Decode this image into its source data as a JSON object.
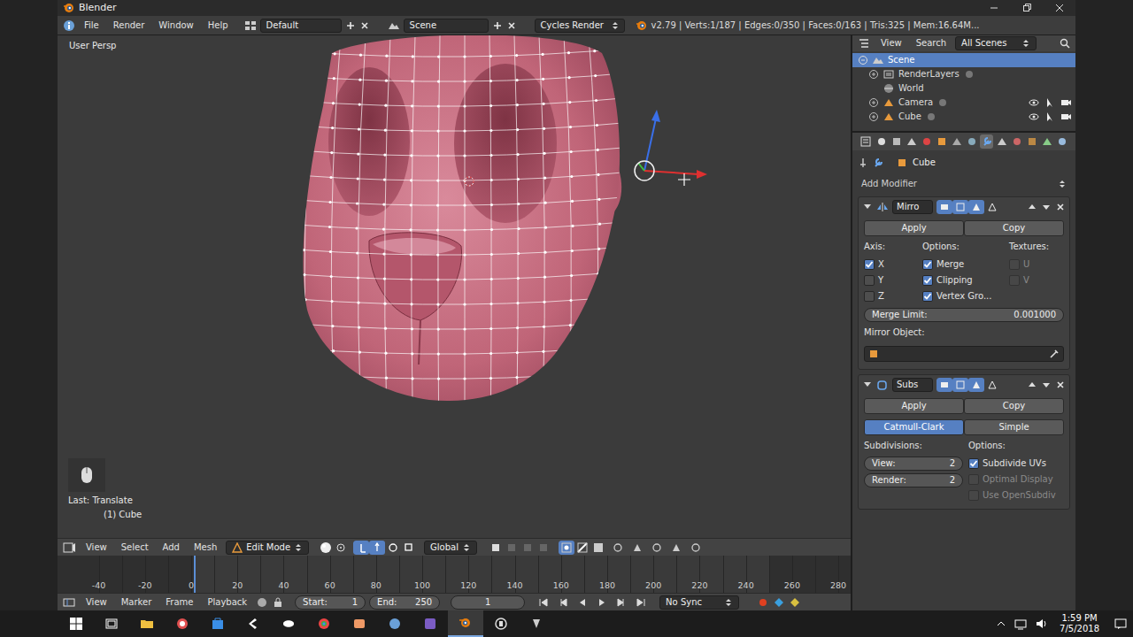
{
  "window": {
    "title": "Blender"
  },
  "info_header": {
    "menus": [
      "File",
      "Render",
      "Window",
      "Help"
    ],
    "layout": "Default",
    "scene": "Scene",
    "engine": "Cycles Render",
    "stats": "v2.79 | Verts:1/187 | Edges:0/350 | Faces:0/163 | Tris:325 | Mem:16.64M..."
  },
  "viewport": {
    "view_name": "User Persp",
    "last_operator": "Last: Translate",
    "object_info": "(1) Cube"
  },
  "view3d_header": {
    "menus": [
      "View",
      "Select",
      "Add",
      "Mesh"
    ],
    "mode": "Edit Mode",
    "orientation": "Global",
    "manipulator_on": true,
    "select_modes": [
      {
        "selected": true
      },
      {
        "selected": false
      },
      {
        "selected": false
      }
    ]
  },
  "timeline": {
    "ticks": [
      "-40",
      "-20",
      "0",
      "20",
      "40",
      "60",
      "80",
      "100",
      "120",
      "140",
      "160",
      "180",
      "200",
      "220",
      "240",
      "260",
      "280"
    ]
  },
  "timeline_header": {
    "menus": [
      "View",
      "Marker",
      "Frame",
      "Playback"
    ],
    "start": "Start:",
    "start_value": "1",
    "end": "End:",
    "end_value": "250",
    "current_frame": "1",
    "sync": "No Sync"
  },
  "outliner": {
    "menus": [
      "View",
      "Search"
    ],
    "filter": "All Scenes",
    "items": [
      {
        "label": "Scene",
        "kind": "scene",
        "selected": true,
        "children": [
          {
            "label": "RenderLayers",
            "kind": "layers",
            "selected": false,
            "expanded": false
          },
          {
            "label": "World",
            "kind": "world",
            "selected": false
          },
          {
            "label": "Camera",
            "kind": "object",
            "selected": false,
            "expanded": false
          },
          {
            "label": "Cube",
            "kind": "object",
            "selected": false,
            "expanded": false
          }
        ]
      }
    ]
  },
  "properties": {
    "tabs": [
      {
        "selected": false
      },
      {
        "selected": false
      },
      {
        "selected": false
      },
      {
        "selected": false
      },
      {
        "selected": false
      },
      {
        "selected": false
      },
      {
        "selected": false
      },
      {
        "selected": true
      },
      {
        "selected": false
      },
      {
        "selected": false
      },
      {
        "selected": false
      },
      {
        "selected": false
      },
      {
        "selected": false
      }
    ],
    "context": "Cube",
    "add_modifier": "Add Modifier",
    "modifiers": [
      {
        "kind": "mirror",
        "name": "Mirro",
        "expanded": true,
        "apply": "Apply",
        "copy": "Copy",
        "axis_label": "Axis:",
        "axes": [
          {
            "label": "X",
            "checked": true,
            "disabled": false
          },
          {
            "label": "Y",
            "checked": false,
            "disabled": false
          },
          {
            "label": "Z",
            "checked": false,
            "disabled": false
          }
        ],
        "options_label": "Options:",
        "options": [
          {
            "label": "Merge",
            "checked": true,
            "disabled": false
          },
          {
            "label": "Clipping",
            "checked": true,
            "disabled": false
          },
          {
            "label": "Vertex Gro...",
            "checked": true,
            "disabled": false
          }
        ],
        "textures_label": "Textures:",
        "textures": [
          {
            "label": "U",
            "checked": false,
            "disabled": true
          },
          {
            "label": "V",
            "checked": false,
            "disabled": true
          }
        ],
        "merge_limit_label": "Merge Limit:",
        "merge_limit": "0.001000",
        "mirror_object_label": "Mirror Object:"
      },
      {
        "kind": "subsurf",
        "name": "Subs",
        "expanded": true,
        "apply": "Apply",
        "copy": "Copy",
        "types": [
          {
            "label": "Catmull-Clark",
            "selected": true
          },
          {
            "label": "Simple",
            "selected": false
          }
        ],
        "subdivisions_label": "Subdivisions:",
        "levels": [
          {
            "label": "View:",
            "value": "2"
          },
          {
            "label": "Render:",
            "value": "2"
          }
        ],
        "options_label": "Options:",
        "options": [
          {
            "label": "Subdivide UVs",
            "checked": true,
            "disabled": false
          },
          {
            "label": "Optimal Display",
            "checked": false,
            "disabled": true
          },
          {
            "label": "Use OpenSubdiv",
            "checked": false,
            "disabled": true
          }
        ]
      }
    ]
  },
  "taskbar": {
    "apps": [
      {
        "selected": false
      },
      {
        "selected": false
      },
      {
        "selected": false
      },
      {
        "selected": false
      },
      {
        "selected": false
      },
      {
        "selected": false
      },
      {
        "selected": false
      },
      {
        "selected": false
      },
      {
        "selected": false
      },
      {
        "selected": false
      },
      {
        "selected": true
      },
      {
        "selected": false
      },
      {
        "selected": false
      }
    ],
    "time": "1:59 PM",
    "date": "7/5/2018"
  }
}
